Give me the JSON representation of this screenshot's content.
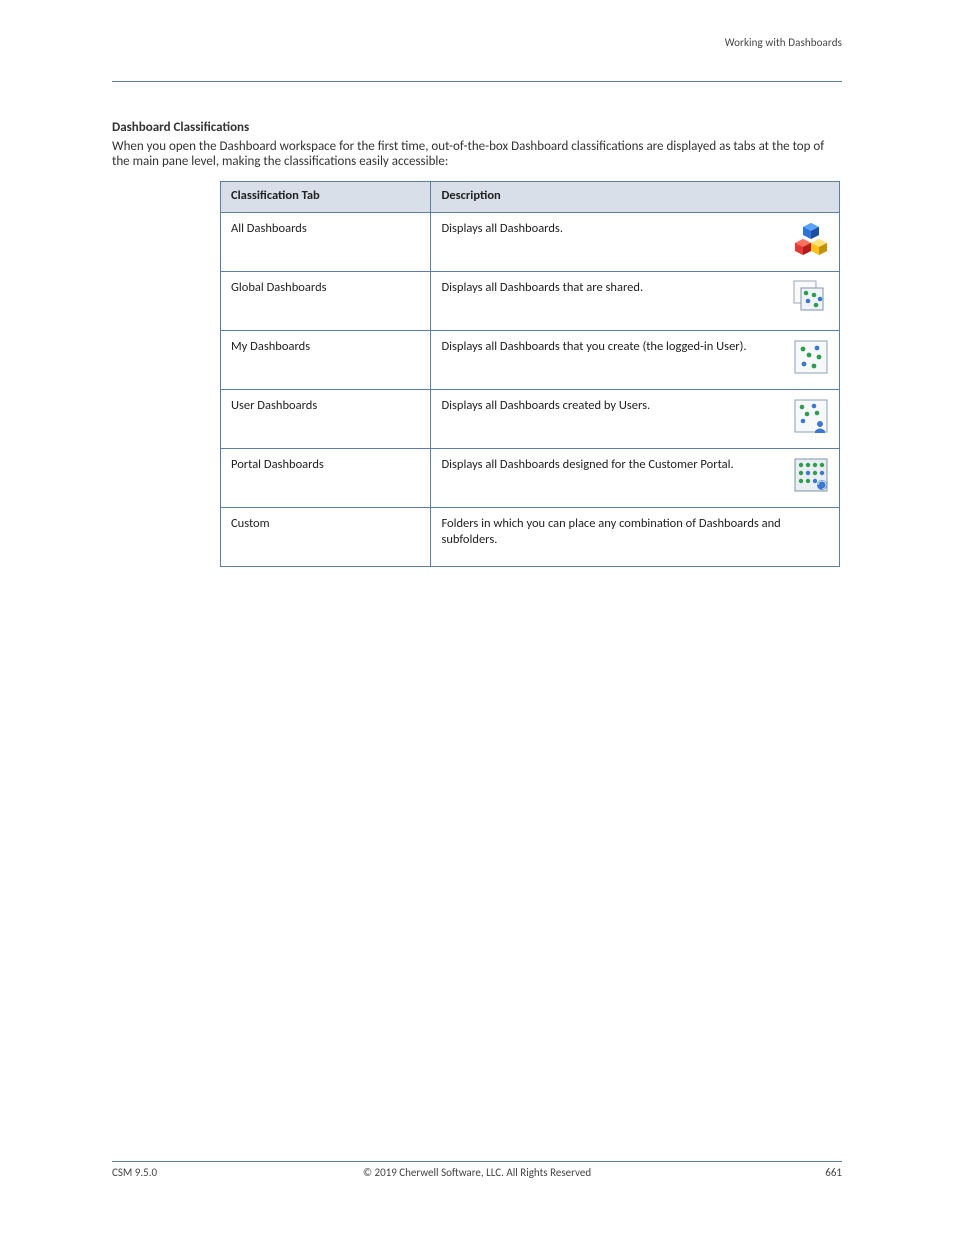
{
  "header": {
    "left": "",
    "right": "Working with Dashboards"
  },
  "section": {
    "title": "Dashboard Classifications",
    "intro": "When you open the Dashboard workspace for the first time, out-of-the-box Dashboard classifications are displayed as tabs at the top of the main pane level, making the classifications easily accessible:"
  },
  "table": {
    "columns": {
      "c0": "Classification Tab",
      "c1": "Description"
    },
    "rows": [
      {
        "class_": "All Dashboards",
        "desc": "Displays all Dashboards.",
        "icon": "cubes-icon"
      },
      {
        "class_": "Global Dashboards",
        "desc": "Displays all Dashboards that are shared.",
        "icon": "global-dashboards-icon"
      },
      {
        "class_": "My Dashboards",
        "desc": "Displays all Dashboards that you create (the logged-in User).",
        "icon": "my-dashboards-icon"
      },
      {
        "class_": "User Dashboards",
        "desc": "Displays all Dashboards created by Users.",
        "icon": "user-dashboards-icon"
      },
      {
        "class_": "Portal Dashboards",
        "desc": "Displays all Dashboards designed for the Customer Portal.",
        "icon": "portal-dashboards-icon"
      },
      {
        "class_": "Custom",
        "desc": "Folders in which you can place any combination of Dashboards and subfolders.",
        "icon": ""
      }
    ]
  },
  "footer": {
    "left": "CSM 9.5.0",
    "center": "© 2019 Cherwell Software, LLC. All Rights Reserved",
    "right": "661"
  },
  "icons": {
    "cubes-icon": "cubes",
    "global-dashboards-icon": "global",
    "my-dashboards-icon": "my",
    "user-dashboards-icon": "user",
    "portal-dashboards-icon": "portal"
  }
}
